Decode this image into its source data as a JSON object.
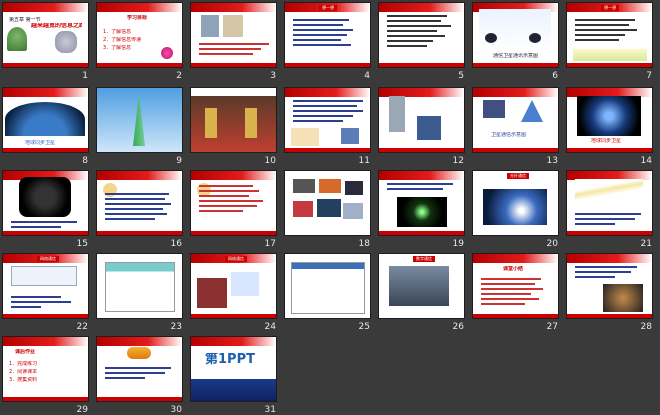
{
  "window": {
    "background": "#3a3a3a"
  },
  "slides": [
    {
      "num": "1",
      "title": "越来越宽的信息之路",
      "subtitle": "第五章 第一节"
    },
    {
      "num": "2",
      "heading": "学习目标",
      "lines": [
        "1．了解信息",
        "2．了解信息传递",
        "3．了解信息"
      ]
    },
    {
      "num": "3"
    },
    {
      "num": "4",
      "tag": "想一想"
    },
    {
      "num": "5"
    },
    {
      "num": "6",
      "caption": "通信卫星通讯示意图"
    },
    {
      "num": "7",
      "tag": "想一想"
    },
    {
      "num": "8",
      "caption": "地球同步卫星"
    },
    {
      "num": "9"
    },
    {
      "num": "10"
    },
    {
      "num": "11"
    },
    {
      "num": "12"
    },
    {
      "num": "13",
      "caption": "卫星通信示意图"
    },
    {
      "num": "14",
      "caption": "地球同步卫星"
    },
    {
      "num": "15"
    },
    {
      "num": "16"
    },
    {
      "num": "17"
    },
    {
      "num": "18"
    },
    {
      "num": "19"
    },
    {
      "num": "20",
      "tag": "光纤通信"
    },
    {
      "num": "21"
    },
    {
      "num": "22",
      "tag": "网络通信"
    },
    {
      "num": "23"
    },
    {
      "num": "24",
      "tag": "网络通信"
    },
    {
      "num": "25"
    },
    {
      "num": "26",
      "tag": "数字通信"
    },
    {
      "num": "27",
      "heading": "课堂小结"
    },
    {
      "num": "28"
    },
    {
      "num": "29",
      "heading": "课后作业",
      "lines": [
        "1．完成练习",
        "2．阅读课本",
        "3．搜集资料"
      ]
    },
    {
      "num": "30"
    },
    {
      "num": "31",
      "logo": "第1PPT"
    }
  ]
}
